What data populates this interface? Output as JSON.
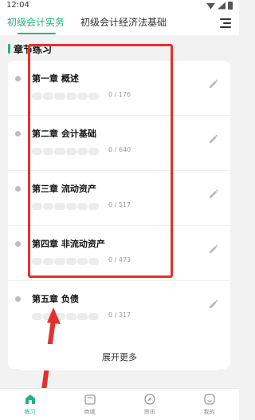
{
  "status_bar": {
    "time": "12:04"
  },
  "header": {
    "tabs": [
      {
        "label": "初级会计实务",
        "active": true
      },
      {
        "label": "初级会计经济法基础",
        "active": false
      }
    ],
    "menu_icon": "menu-icon"
  },
  "section": {
    "title": "章节练习"
  },
  "chapters": [
    {
      "title": "第一章 概述",
      "progress": "0 / 176"
    },
    {
      "title": "第二章 会计基础",
      "progress": "0 / 640"
    },
    {
      "title": "第三章 流动资产",
      "progress": "0 / 517"
    },
    {
      "title": "第四章 非流动资产",
      "progress": "0 / 473"
    },
    {
      "title": "第五章 负债",
      "progress": "0 / 317"
    }
  ],
  "expand_button": {
    "label": "展开更多"
  },
  "bottom_nav": [
    {
      "label": "练习",
      "icon": "home-icon",
      "active": true
    },
    {
      "label": "商城",
      "icon": "shop-icon",
      "active": false
    },
    {
      "label": "资讯",
      "icon": "compass-icon",
      "active": false
    },
    {
      "label": "我的",
      "icon": "profile-icon",
      "active": false
    }
  ],
  "colors": {
    "accent": "#27b07c",
    "annotation": "#e3312f",
    "background": "#f2f2f2"
  }
}
